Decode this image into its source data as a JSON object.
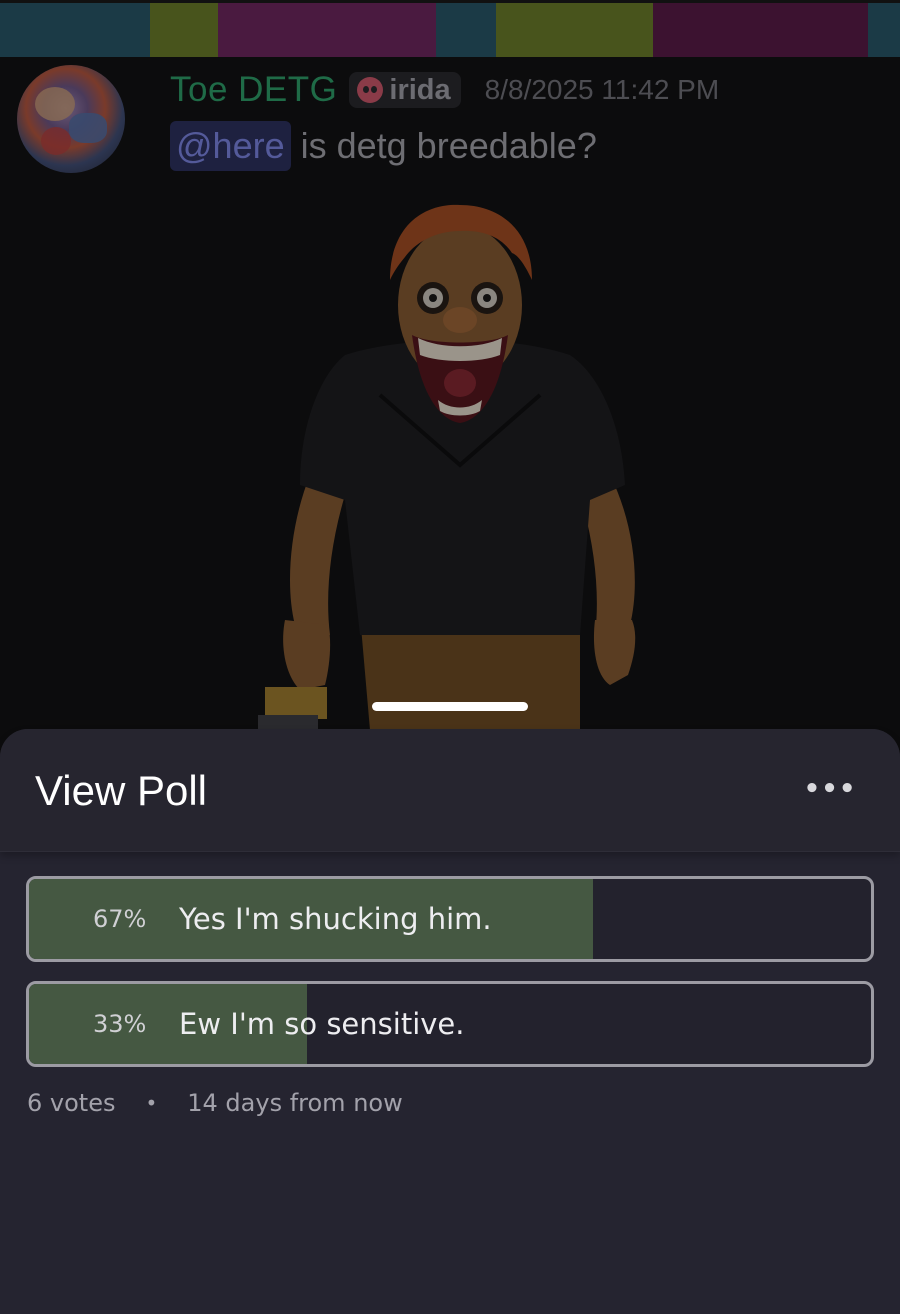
{
  "banner": {
    "colors": [
      "#1b3a46",
      "#48541c",
      "#4a1a40",
      "#1b3a46",
      "#48541c",
      "#3c1230",
      "#1b3a46"
    ]
  },
  "message": {
    "username": "Toe DETG",
    "username_color": "#1f6b47",
    "server_tag": "irida",
    "server_tag_icon": "skull-icon",
    "timestamp": "8/8/2025 11:42 PM",
    "mention": "@here",
    "text": "is detg breedable?"
  },
  "poll_sheet": {
    "title": "View Poll",
    "more_icon": "ellipsis-icon",
    "more_label": "•••",
    "options": [
      {
        "percent_label": "67%",
        "percent": 67,
        "label": "Yes I'm shucking him."
      },
      {
        "percent_label": "33%",
        "percent": 33,
        "label": "Ew I'm so sensitive."
      }
    ],
    "votes": "6 votes",
    "separator": "•",
    "time_left": "14 days from now",
    "fill_color": "#455842"
  }
}
